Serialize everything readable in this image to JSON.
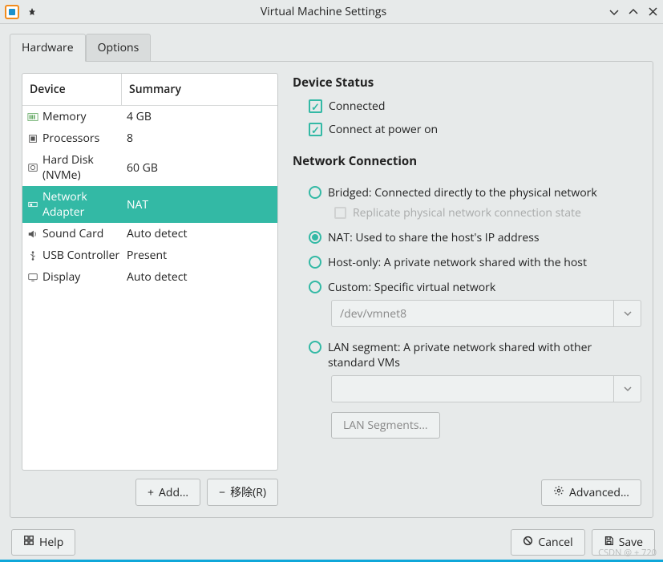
{
  "window": {
    "title": "Virtual Machine Settings"
  },
  "tabs": {
    "hardware": "Hardware",
    "options": "Options"
  },
  "table": {
    "head_device": "Device",
    "head_summary": "Summary",
    "rows": [
      {
        "name": "Memory",
        "summary": "4 GB",
        "icon": "memory"
      },
      {
        "name": "Processors",
        "summary": "8",
        "icon": "cpu"
      },
      {
        "name": "Hard Disk (NVMe)",
        "summary": "60 GB",
        "icon": "disk"
      },
      {
        "name": "Network Adapter",
        "summary": "NAT",
        "icon": "net",
        "selected": true
      },
      {
        "name": "Sound Card",
        "summary": "Auto detect",
        "icon": "sound"
      },
      {
        "name": "USB Controller",
        "summary": "Present",
        "icon": "usb"
      },
      {
        "name": "Display",
        "summary": "Auto detect",
        "icon": "display"
      }
    ]
  },
  "buttons": {
    "add": "Add...",
    "remove": "移除(R)",
    "advanced": "Advanced...",
    "lan_segments": "LAN Segments...",
    "help": "Help",
    "cancel": "Cancel",
    "save": "Save"
  },
  "detail": {
    "status_title": "Device Status",
    "connected": "Connected",
    "connect_power": "Connect at power on",
    "net_title": "Network Connection",
    "bridged": "Bridged: Connected directly to the physical network",
    "replicate": "Replicate physical network connection state",
    "nat": "NAT: Used to share the host's IP address",
    "hostonly": "Host-only: A private network shared with the host",
    "custom": "Custom: Specific virtual network",
    "custom_value": "/dev/vmnet8",
    "lan": "LAN segment: A private network shared with other standard VMs",
    "lan_value": ""
  },
  "watermark": "CSDN @ + 720"
}
